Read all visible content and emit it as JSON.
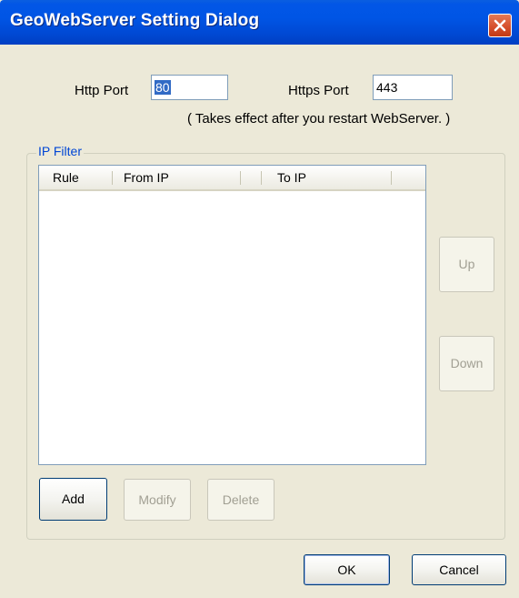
{
  "window": {
    "title": "GeoWebServer Setting Dialog"
  },
  "ports": {
    "http_label": "Http Port",
    "http_value": "80",
    "https_label": "Https Port",
    "https_value": "443",
    "note": "( Takes effect after you restart WebServer. )"
  },
  "ip_filter": {
    "group_label": "IP Filter",
    "columns": [
      "Rule",
      "From IP",
      "To IP"
    ],
    "rows": []
  },
  "buttons": {
    "up": "Up",
    "down": "Down",
    "add": "Add",
    "modify": "Modify",
    "delete": "Delete",
    "ok": "OK",
    "cancel": "Cancel"
  },
  "colors": {
    "titlebar": "#0055e5",
    "dialog_bg": "#ece9d8",
    "group_label": "#0046d5",
    "close_button": "#d6502c"
  }
}
